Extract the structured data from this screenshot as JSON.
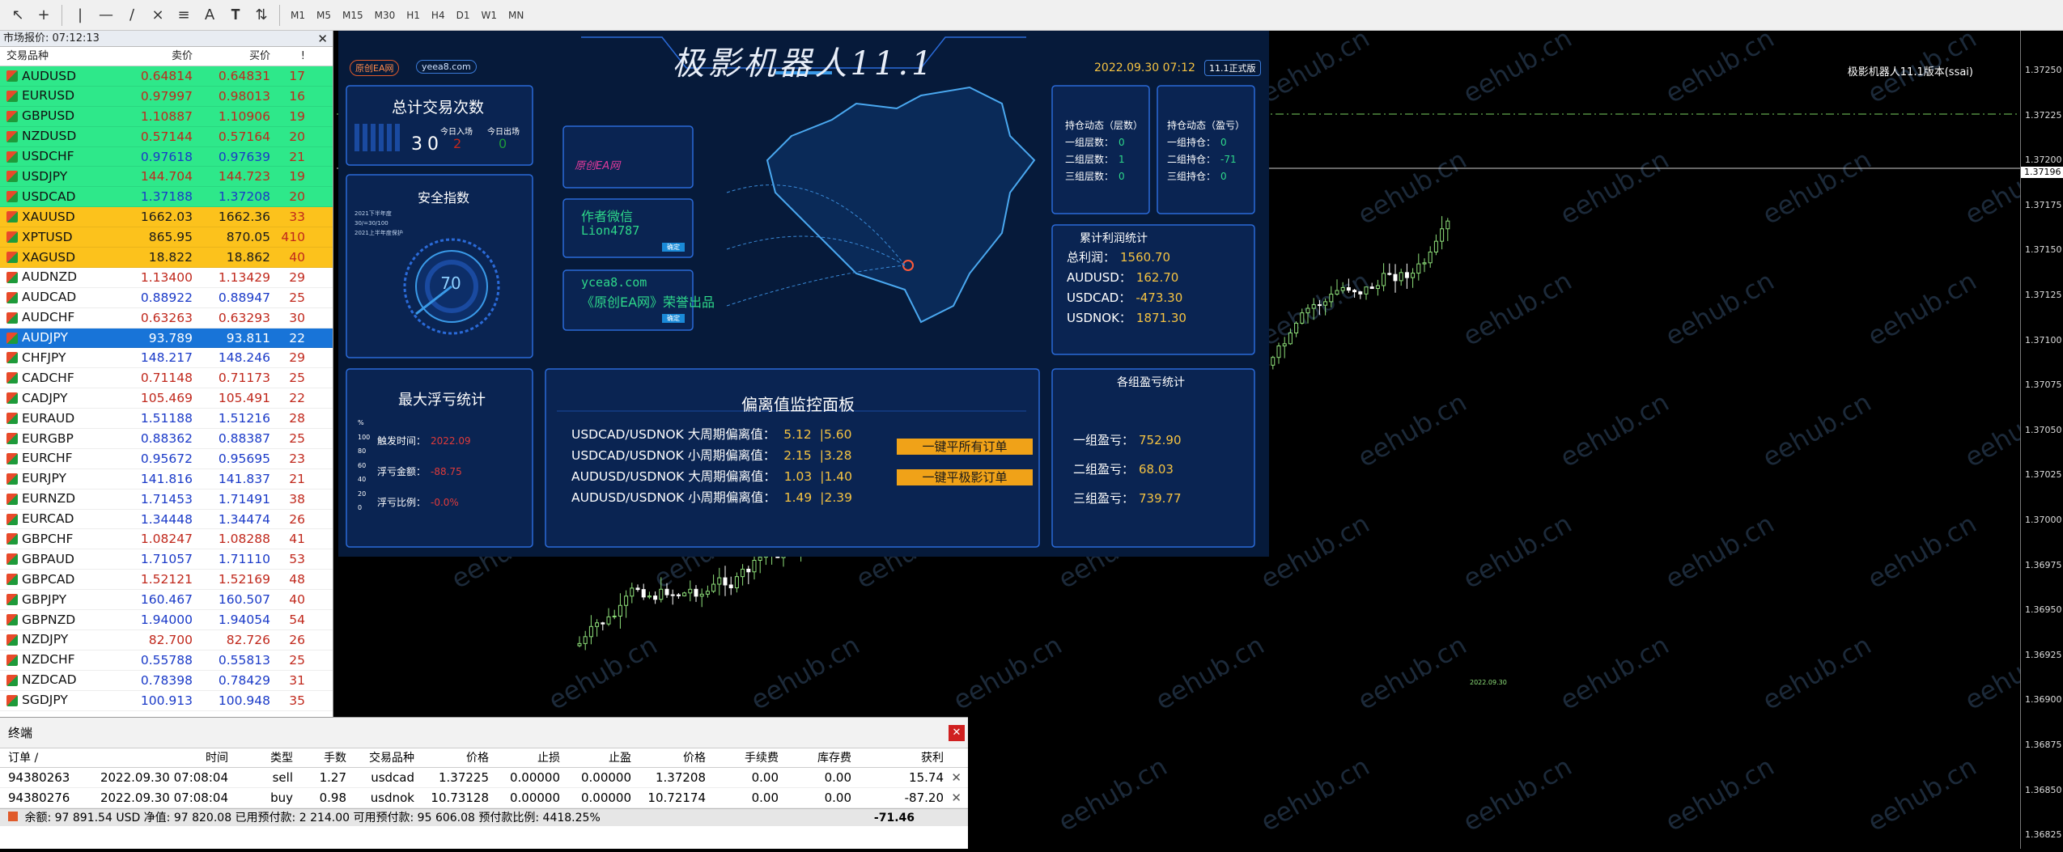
{
  "toolbar": {
    "icons": [
      "cursor-icon",
      "crosshair-icon",
      "vertical-line-icon",
      "horizontal-line-icon",
      "trendline-icon",
      "fibonacci-icon",
      "channel-icon",
      "text-icon",
      "label-icon",
      "arrow-tools-icon"
    ],
    "timeframes": [
      "M1",
      "M5",
      "M15",
      "M30",
      "H1",
      "H4",
      "D1",
      "W1",
      "MN"
    ]
  },
  "market": {
    "title": "市场报价: 07:12:13",
    "headers": {
      "symbol": "交易品种",
      "bid": "卖价",
      "ask": "买价",
      "spread": "!"
    },
    "rows": [
      {
        "s": "AUDUSD",
        "b": "0.64814",
        "a": "0.64831",
        "p": "17",
        "bg": "#2ee88a",
        "fg": "#c0281c"
      },
      {
        "s": "EURUSD",
        "b": "0.97997",
        "a": "0.98013",
        "p": "16",
        "bg": "#2ee88a",
        "fg": "#c0281c"
      },
      {
        "s": "GBPUSD",
        "b": "1.10887",
        "a": "1.10906",
        "p": "19",
        "bg": "#2ee88a",
        "fg": "#c0281c"
      },
      {
        "s": "NZDUSD",
        "b": "0.57144",
        "a": "0.57164",
        "p": "20",
        "bg": "#2ee88a",
        "fg": "#c0281c"
      },
      {
        "s": "USDCHF",
        "b": "0.97618",
        "a": "0.97639",
        "p": "21",
        "bg": "#2ee88a",
        "fg": "#1a3ac8"
      },
      {
        "s": "USDJPY",
        "b": "144.704",
        "a": "144.723",
        "p": "19",
        "bg": "#2ee88a",
        "fg": "#c0281c"
      },
      {
        "s": "USDCAD",
        "b": "1.37188",
        "a": "1.37208",
        "p": "20",
        "bg": "#2ee88a",
        "fg": "#1a3ac8"
      },
      {
        "s": "XAUUSD",
        "b": "1662.03",
        "a": "1662.36",
        "p": "33",
        "bg": "#fcc21c",
        "fg": "#1a1a1a"
      },
      {
        "s": "XPTUSD",
        "b": "865.95",
        "a": "870.05",
        "p": "410",
        "bg": "#fcc21c",
        "fg": "#1a1a1a"
      },
      {
        "s": "XAGUSD",
        "b": "18.822",
        "a": "18.862",
        "p": "40",
        "bg": "#fcc21c",
        "fg": "#1a1a1a"
      },
      {
        "s": "AUDNZD",
        "b": "1.13400",
        "a": "1.13429",
        "p": "29",
        "bg": "#ffffff",
        "fg": "#c0281c"
      },
      {
        "s": "AUDCAD",
        "b": "0.88922",
        "a": "0.88947",
        "p": "25",
        "bg": "#ffffff",
        "fg": "#1a3ac8"
      },
      {
        "s": "AUDCHF",
        "b": "0.63263",
        "a": "0.63293",
        "p": "30",
        "bg": "#ffffff",
        "fg": "#c0281c"
      },
      {
        "s": "AUDJPY",
        "b": "93.789",
        "a": "93.811",
        "p": "22",
        "bg": "#1874d8",
        "fg": "#ffffff"
      },
      {
        "s": "CHFJPY",
        "b": "148.217",
        "a": "148.246",
        "p": "29",
        "bg": "#ffffff",
        "fg": "#1a3ac8"
      },
      {
        "s": "CADCHF",
        "b": "0.71148",
        "a": "0.71173",
        "p": "25",
        "bg": "#ffffff",
        "fg": "#c0281c"
      },
      {
        "s": "CADJPY",
        "b": "105.469",
        "a": "105.491",
        "p": "22",
        "bg": "#ffffff",
        "fg": "#c0281c"
      },
      {
        "s": "EURAUD",
        "b": "1.51188",
        "a": "1.51216",
        "p": "28",
        "bg": "#ffffff",
        "fg": "#1a3ac8"
      },
      {
        "s": "EURGBP",
        "b": "0.88362",
        "a": "0.88387",
        "p": "25",
        "bg": "#ffffff",
        "fg": "#1a3ac8"
      },
      {
        "s": "EURCHF",
        "b": "0.95672",
        "a": "0.95695",
        "p": "23",
        "bg": "#ffffff",
        "fg": "#1a3ac8"
      },
      {
        "s": "EURJPY",
        "b": "141.816",
        "a": "141.837",
        "p": "21",
        "bg": "#ffffff",
        "fg": "#1a3ac8"
      },
      {
        "s": "EURNZD",
        "b": "1.71453",
        "a": "1.71491",
        "p": "38",
        "bg": "#ffffff",
        "fg": "#1a3ac8"
      },
      {
        "s": "EURCAD",
        "b": "1.34448",
        "a": "1.34474",
        "p": "26",
        "bg": "#ffffff",
        "fg": "#1a3ac8"
      },
      {
        "s": "GBPCHF",
        "b": "1.08247",
        "a": "1.08288",
        "p": "41",
        "bg": "#ffffff",
        "fg": "#c0281c"
      },
      {
        "s": "GBPAUD",
        "b": "1.71057",
        "a": "1.71110",
        "p": "53",
        "bg": "#ffffff",
        "fg": "#1a3ac8"
      },
      {
        "s": "GBPCAD",
        "b": "1.52121",
        "a": "1.52169",
        "p": "48",
        "bg": "#ffffff",
        "fg": "#c0281c"
      },
      {
        "s": "GBPJPY",
        "b": "160.467",
        "a": "160.507",
        "p": "40",
        "bg": "#ffffff",
        "fg": "#1a3ac8"
      },
      {
        "s": "GBPNZD",
        "b": "1.94000",
        "a": "1.94054",
        "p": "54",
        "bg": "#ffffff",
        "fg": "#1a3ac8"
      },
      {
        "s": "NZDJPY",
        "b": "82.700",
        "a": "82.726",
        "p": "26",
        "bg": "#ffffff",
        "fg": "#c0281c"
      },
      {
        "s": "NZDCHF",
        "b": "0.55788",
        "a": "0.55813",
        "p": "25",
        "bg": "#ffffff",
        "fg": "#1a3ac8"
      },
      {
        "s": "NZDCAD",
        "b": "0.78398",
        "a": "0.78429",
        "p": "31",
        "bg": "#ffffff",
        "fg": "#1a3ac8"
      },
      {
        "s": "SGDJPY",
        "b": "100.913",
        "a": "100.948",
        "p": "35",
        "bg": "#ffffff",
        "fg": "#1a3ac8"
      }
    ]
  },
  "chart": {
    "label": "极影机器人11.1版本(ssai)",
    "yticks": [
      "1.37250",
      "1.37225",
      "1.37200",
      "1.37175",
      "1.37150",
      "1.37125",
      "1.37100",
      "1.37075",
      "1.37050",
      "1.37025",
      "1.37000",
      "1.36975",
      "1.36950",
      "1.36925",
      "1.36900",
      "1.36875",
      "1.36850",
      "1.36825"
    ],
    "current_price": "1.37196",
    "date_mark": "2022.09.30",
    "watermark": "eehub.cn",
    "up_color": "#8ee07a",
    "down_color": "#ffffff"
  },
  "dash": {
    "title": "极影机器人11.1",
    "tag1": "原创EA网",
    "tag2": "yeea8.com",
    "datetime": "2022.09.30 07:12",
    "version": "11.1正式版",
    "trades": {
      "title": "总计交易次数",
      "count": "30",
      "in_label": "今日入场",
      "out_label": "今日出场",
      "in_val": "2",
      "out_val": "0"
    },
    "safety": {
      "title": "安全指数",
      "value": "70",
      "legend": [
        "2021下半年度",
        "30/=30/100",
        "2021上半年度保护"
      ]
    },
    "promo": {
      "logo": "原创EA网",
      "wechat_label": "作者微信",
      "wechat_id": "Lion4787",
      "site": "ycea8.com",
      "slogan": "《原创EA网》荣誉出品",
      "btn": "确定"
    },
    "pos_layers": {
      "title": "持仓动态（层数）",
      "rows": [
        {
          "k": "一组层数：",
          "v": "0"
        },
        {
          "k": "二组层数：",
          "v": "1"
        },
        {
          "k": "三组层数：",
          "v": "0"
        }
      ]
    },
    "pos_pnl": {
      "title": "持仓动态（盈亏）",
      "rows": [
        {
          "k": "一组持仓：",
          "v": "0"
        },
        {
          "k": "二组持仓：",
          "v": "-71"
        },
        {
          "k": "三组持仓：",
          "v": "0"
        }
      ]
    },
    "profit": {
      "title": "累计利润统计",
      "rows": [
        {
          "k": "总利润：",
          "v": "1560.70"
        },
        {
          "k": "AUDUSD：",
          "v": "162.70"
        },
        {
          "k": "USDCAD：",
          "v": "-473.30"
        },
        {
          "k": "USDNOK：",
          "v": "1871.30"
        }
      ]
    },
    "maxloss": {
      "title": "最大浮亏统计",
      "axis": [
        "%",
        "100",
        "80",
        "60",
        "40",
        "20",
        "0"
      ],
      "rows": [
        {
          "k": "触发时间：",
          "v": "2022.09"
        },
        {
          "k": "浮亏金额：",
          "v": "-88.75"
        },
        {
          "k": "浮亏比例：",
          "v": "-0.0%"
        }
      ]
    },
    "deviation": {
      "title": "偏离值监控面板",
      "rows": [
        {
          "k": "USDCAD/USDNOK 大周期偏离值：",
          "a": "5.12",
          "b": "5.60"
        },
        {
          "k": "USDCAD/USDNOK 小周期偏离值：",
          "a": "2.15",
          "b": "3.28"
        },
        {
          "k": "AUDUSD/USDNOK 大周期偏离值：",
          "a": "1.03",
          "b": "1.40"
        },
        {
          "k": "AUDUSD/USDNOK 小周期偏离值：",
          "a": "1.49",
          "b": "2.39"
        }
      ],
      "btn1": "一键平所有订单",
      "btn2": "一键平极影订单"
    },
    "groups": {
      "title": "各组盈亏统计",
      "rows": [
        {
          "k": "一组盈亏：",
          "v": "752.90"
        },
        {
          "k": "二组盈亏：",
          "v": "68.03"
        },
        {
          "k": "三组盈亏：",
          "v": "739.77"
        }
      ]
    }
  },
  "terminal": {
    "title": "终端",
    "headers": [
      "订单 /",
      "时间",
      "类型",
      "手数",
      "交易品种",
      "价格",
      "止损",
      "止盈",
      "价格",
      "手续费",
      "库存费",
      "获利"
    ],
    "rows": [
      [
        "94380263",
        "2022.09.30 07:08:04",
        "sell",
        "1.27",
        "usdcad",
        "1.37225",
        "0.00000",
        "0.00000",
        "1.37208",
        "0.00",
        "0.00",
        "15.74"
      ],
      [
        "94380276",
        "2022.09.30 07:08:04",
        "buy",
        "0.98",
        "usdnok",
        "10.73128",
        "0.00000",
        "0.00000",
        "10.72174",
        "0.00",
        "0.00",
        "-87.20"
      ]
    ],
    "summary": "余额: 97 891.54 USD  净值: 97 820.08  已用预付款: 2 214.00  可用预付款: 95 606.08  预付款比例: 4418.25%",
    "total": "-71.46"
  }
}
